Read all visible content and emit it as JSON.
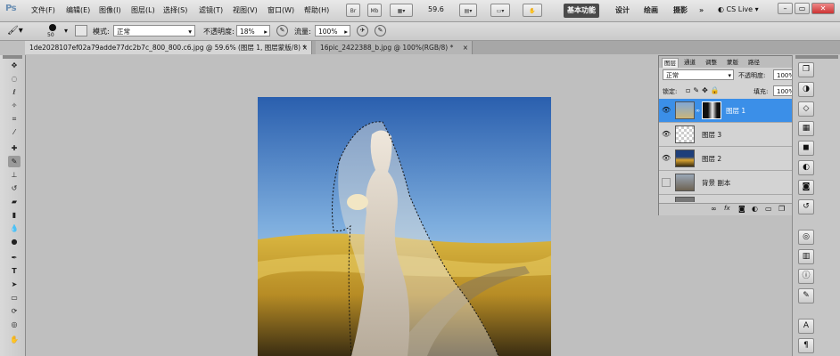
{
  "app": {
    "logo": "Ps"
  },
  "menu": [
    "文件(F)",
    "编辑(E)",
    "图像(I)",
    "图层(L)",
    "选择(S)",
    "滤镜(T)",
    "视图(V)",
    "窗口(W)",
    "帮助(H)"
  ],
  "menubar": {
    "btn_br": "Br",
    "btn_mb": "Mb",
    "zoom": "59.6",
    "workspaces": [
      "基本功能",
      "设计",
      "绘画",
      "摄影"
    ],
    "more": "»",
    "cslive": "CS Live",
    "win_min": "–",
    "win_restore": "▭",
    "win_close": "✕"
  },
  "options": {
    "brush_size": "50",
    "mode_label": "模式:",
    "mode_value": "正常",
    "opacity_label": "不透明度:",
    "opacity_value": "18%",
    "flow_label": "流量:",
    "flow_value": "100%"
  },
  "tabs": [
    {
      "label": "1de2028107ef02a79adde77dc2b7c_800_800.c6.jpg @ 59.6% (图层 1, 图层蒙版/8) *",
      "close": "×"
    },
    {
      "label": "16pic_2422388_b.jpg @ 100%(RGB/8) *",
      "close": "×"
    }
  ],
  "layers_panel": {
    "tabs": [
      "图层",
      "通道",
      "调整",
      "蒙版",
      "路径"
    ],
    "blend_mode": "正常",
    "opacity_label": "不透明度:",
    "opacity_value": "100%",
    "lock_label": "锁定:",
    "fill_label": "填充:",
    "fill_value": "100%",
    "layers": [
      {
        "name": "图层 1",
        "visible": true,
        "selected": true
      },
      {
        "name": "图层 3",
        "visible": true,
        "selected": false
      },
      {
        "name": "图层 2",
        "visible": true,
        "selected": false
      },
      {
        "name": "背景 副本",
        "visible": false,
        "selected": false
      }
    ],
    "footer_icons": [
      "link-icon",
      "fx-icon",
      "mask-icon",
      "adjustment-icon",
      "folder-icon",
      "new-layer-icon",
      "trash-icon"
    ]
  },
  "colors": {
    "selected_layer": "#3b8fe8",
    "workspace_active": "#4a4a4a",
    "sky_top": "#2a5fae",
    "field": "#c9a234"
  }
}
